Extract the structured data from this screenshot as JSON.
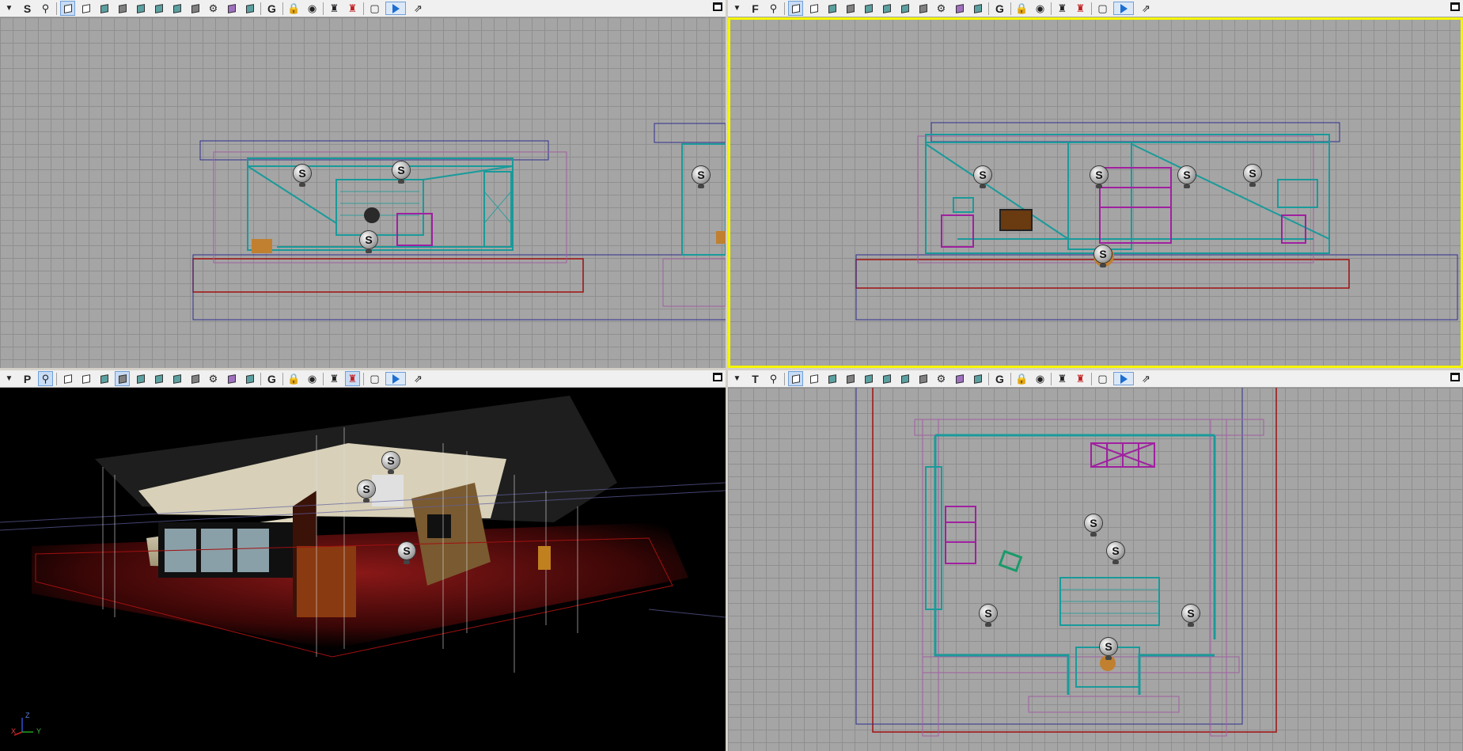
{
  "viewports": {
    "side": {
      "label": "S"
    },
    "front": {
      "label": "F"
    },
    "perspective": {
      "label": "P"
    },
    "top": {
      "label": "T"
    }
  },
  "toolbar_icons": [
    "dropdown-arrow-icon",
    "view-letter",
    "camera-icon",
    "wireframe-cube-icon",
    "shaded-cube-icon",
    "transparent-cube-icon",
    "solid-cube-icon",
    "textured-cube-icon",
    "flat-cube-icon",
    "lit-cube-icon",
    "smooth-cube-icon",
    "gear-cube-icon",
    "purple-cube-icon",
    "detail-cube-icon",
    "grid-g-icon",
    "lock-icon",
    "eye-icon",
    "joystick-icon",
    "red-joystick-icon",
    "frame-icon",
    "play-icon",
    "maximize-icon"
  ],
  "light_marker_label": "S",
  "axes_labels": {
    "z": "Z",
    "x": "X",
    "y": "Y"
  },
  "colors": {
    "grid_bg": "#a5a5a5",
    "wire_teal": "#1a9a9a",
    "wire_purple": "#a020a0",
    "bound_red": "#a01010",
    "bound_blue": "#303090",
    "selected_border": "#f5f500"
  }
}
